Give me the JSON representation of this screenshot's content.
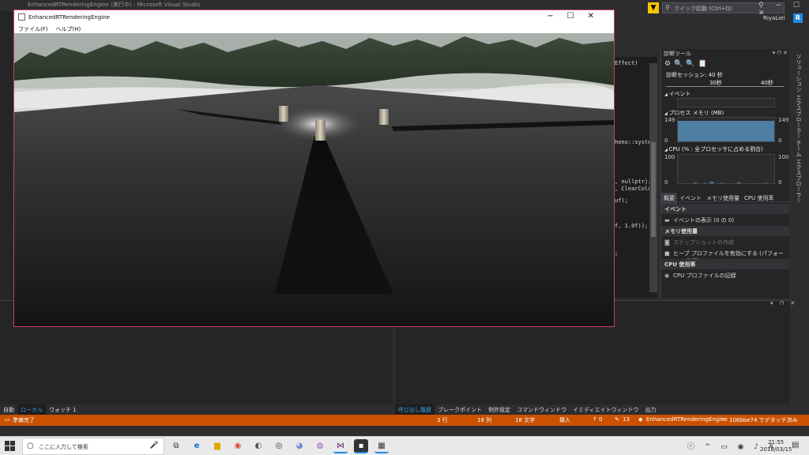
{
  "vs": {
    "title": "EnhancedRTRenderingEngine (実行中) - Microsoft Visual Studio",
    "quick_launch_placeholder": "クイック起動 (Ctrl+Q)",
    "user_name": "RiyaLiel",
    "avatar_letter": "R",
    "code_lines": [
      "Effect)",
      "hono::system_",
      ", nullptr);",
      ", ClearColor",
      "uf);",
      "f, 1.0f));",
      ";"
    ]
  },
  "diag": {
    "title": "診断ツール",
    "session": "診断セッション: 40 秒",
    "timeline_t1": "30秒",
    "timeline_t2": "40秒",
    "events_label": "イベント",
    "memory_label": "プロセス メモリ (MB)",
    "memory_max_left": "149",
    "memory_min_left": "0",
    "memory_max_right": "149",
    "memory_min_right": "0",
    "memory_fraction": 0.88,
    "cpu_label": "CPU (% : 全プロセッサに占める割合)",
    "cpu_max_left": "100",
    "cpu_min_left": "0",
    "cpu_max_right": "100",
    "cpu_min_right": "0",
    "cpu_samples": [
      2,
      4,
      2,
      6,
      3,
      9,
      5,
      3,
      7,
      4,
      12,
      5,
      3,
      8,
      4,
      2,
      6,
      3,
      10,
      4,
      2,
      5,
      3,
      2,
      6,
      3,
      7,
      4,
      3,
      2
    ],
    "tabs": [
      "概要",
      "イベント",
      "メモリ使用量",
      "CPU 使用率"
    ],
    "sections": {
      "events": "イベント",
      "show_events": "イベントの表示 (0 の 0)",
      "memory_usage": "メモリ使用量",
      "snapshot": "スナップショットの作成",
      "heap_profile": "ヒープ プロファイルを有効にする (パフォーマンスに影響しま",
      "cpu_usage": "CPU 使用率",
      "cpu_profile": "CPU プロファイルの記録"
    },
    "side_tabs": "ソリューション エクスプローラー  チーム エクスプローラー"
  },
  "app": {
    "title": "EnhancedRTRenderingEngine",
    "menu": [
      "ファイル(F)",
      "ヘルプ(H)"
    ]
  },
  "bottom_tabs_left": [
    "自動",
    "ローカル",
    "ウォッチ 1"
  ],
  "bottom_tabs_right": [
    "呼び出し履歴",
    "ブレークポイント",
    "例外設定",
    "コマンドウィンドウ",
    "イミディエイトウィンドウ",
    "出力"
  ],
  "status": {
    "ready": "準備完了",
    "line": "3 行",
    "col": "18 列",
    "ch": "18 文字",
    "mode": "挿入",
    "up": "0",
    "pencil": "13",
    "repo": "EnhancedRTRenderingEngine",
    "branch": "106bbe74 でデタッチ済み"
  },
  "taskbar": {
    "search_placeholder": "ここに入力して検索",
    "time": "21:55",
    "date": "2018/03/15",
    "ime": "A"
  }
}
